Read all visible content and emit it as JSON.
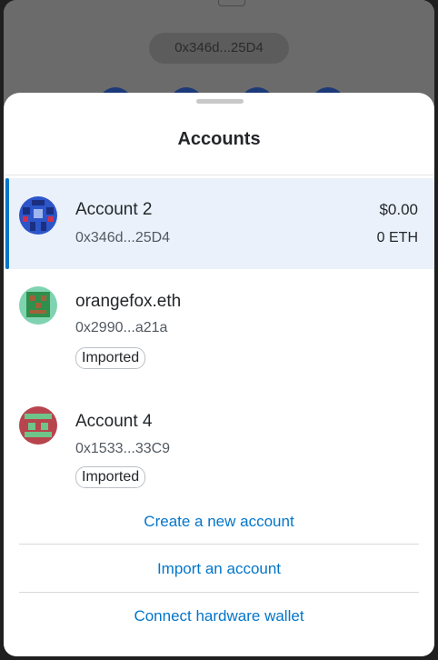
{
  "background": {
    "address_pill": "0x346d...25D4"
  },
  "sheet": {
    "title": "Accounts"
  },
  "accounts": [
    {
      "name": "Account 2",
      "address": "0x346d...25D4",
      "balance_fiat": "$0.00",
      "balance_eth": "0 ETH",
      "selected": true,
      "badge": ""
    },
    {
      "name": "orangefox.eth",
      "address": "0x2990...a21a",
      "badge": "Imported"
    },
    {
      "name": "Account 4",
      "address": "0x1533...33C9",
      "badge": "Imported"
    }
  ],
  "actions": {
    "create": "Create a new account",
    "import": "Import an account",
    "hardware": "Connect hardware wallet"
  },
  "colors": {
    "accent": "#0376c9",
    "selected_bg": "#eaf1fb",
    "overlay": "#6b6b6b"
  }
}
